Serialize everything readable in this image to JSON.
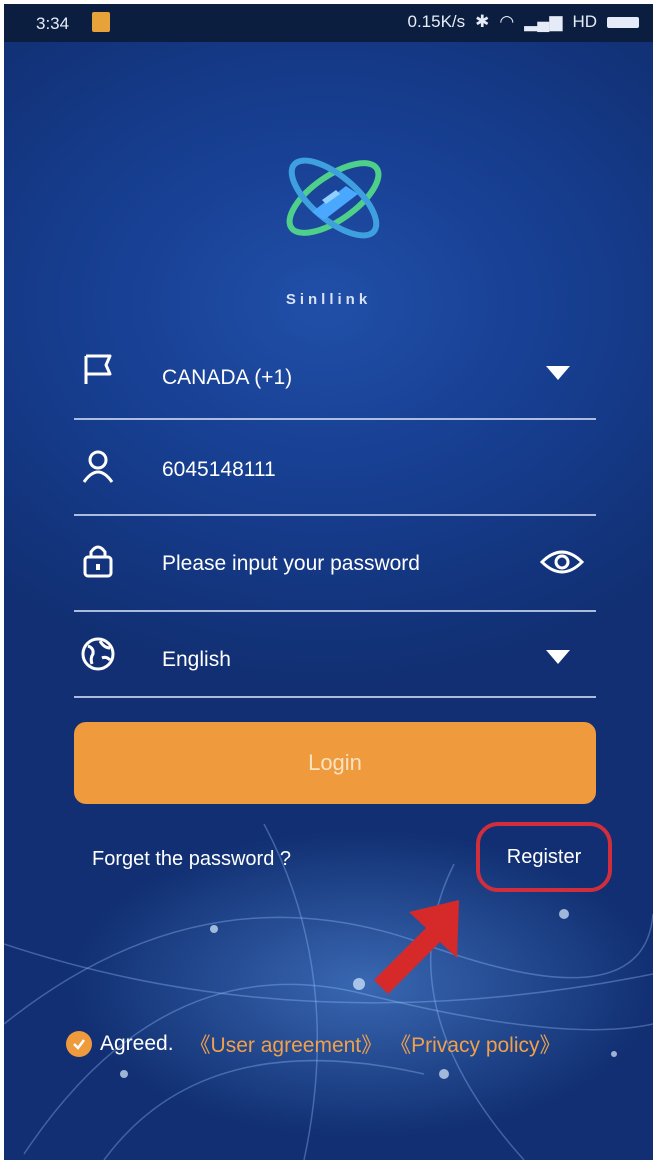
{
  "status_bar": {
    "time": "3:34",
    "network_speed": "0.15K/s",
    "hd_label": "HD"
  },
  "brand": {
    "name": "Sinllink"
  },
  "form": {
    "country": {
      "value": "CANADA (+1)",
      "icon": "flag-icon"
    },
    "phone": {
      "value": "6045148111",
      "icon": "user-icon"
    },
    "password": {
      "placeholder": "Please input your password",
      "icon": "lock-icon",
      "toggle_icon": "eye-icon"
    },
    "language": {
      "value": "English",
      "icon": "globe-icon"
    }
  },
  "buttons": {
    "login": "Login",
    "forgot": "Forget the password ?",
    "register": "Register"
  },
  "agreement": {
    "agreed": "Agreed.",
    "user_agreement": "《User agreement》",
    "privacy_policy": "《Privacy policy》",
    "checked": true
  },
  "colors": {
    "accent": "#ef9a3d",
    "highlight": "#cf2e3c",
    "background": "#173f92"
  }
}
